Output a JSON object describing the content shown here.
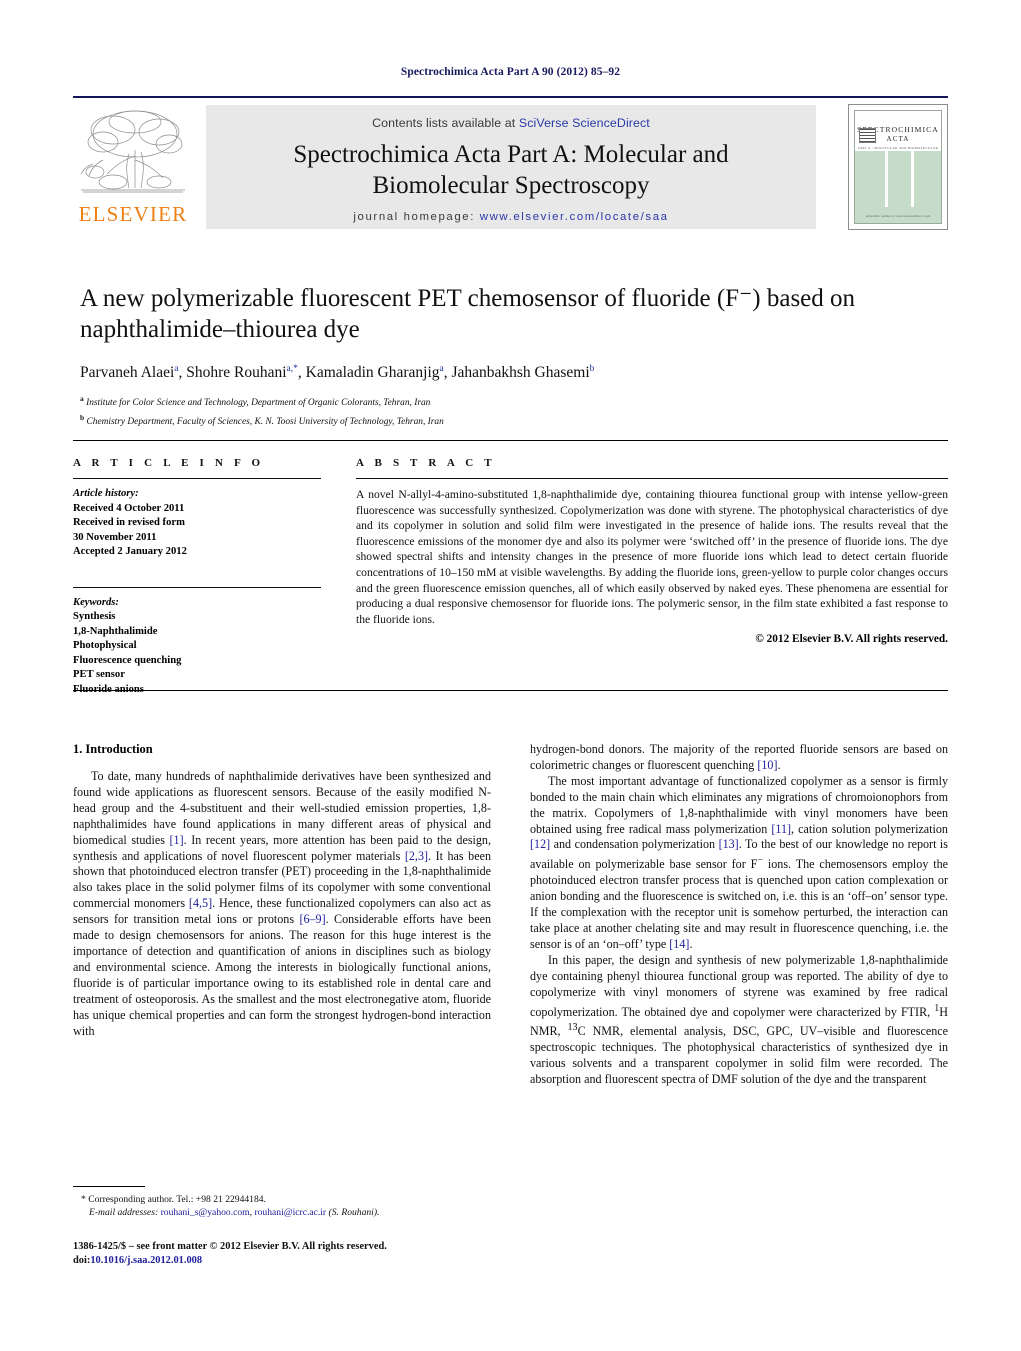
{
  "running_head": "Spectrochimica Acta Part A 90 (2012) 85–92",
  "masthead": {
    "publisher_name": "ELSEVIER",
    "contents_prefix": "Contents lists available at ",
    "contents_link": "SciVerse ScienceDirect",
    "journal_title_line1": "Spectrochimica Acta Part A: Molecular and",
    "journal_title_line2": "Biomolecular Spectroscopy",
    "homepage_label": "journal homepage:",
    "homepage_url": "www.elsevier.com/locate/saa",
    "cover": {
      "title": "SPECTROCHIMICA",
      "subtitle": "ACTA",
      "tagline": "PART A : MOLECULAR AND BIOMOLECULAR SPECTROSCOPY",
      "footer": "Available online at www.sciencedirect.com"
    }
  },
  "article": {
    "title": "A new polymerizable fluorescent PET chemosensor of fluoride (F⁻) based on naphthalimide–thiourea dye",
    "authors_html": "Parvaneh Alaei<sup>a</sup>, Shohre Rouhani<sup>a,*</sup>, Kamaladin Gharanjig<sup>a</sup>, Jahanbakhsh Ghasemi<sup>b</sup>",
    "affiliation_a": "Institute for Color Science and Technology, Department of Organic Colorants, Tehran, Iran",
    "affiliation_b": "Chemistry Department, Faculty of Sciences, K. N. Toosi University of Technology, Tehran, Iran"
  },
  "article_info": {
    "heading": "A R T I C L E    I N F O",
    "history_label": "Article history:",
    "received": "Received 4 October 2011",
    "revised_label": "Received in revised form",
    "revised_date": "30 November 2011",
    "accepted": "Accepted 2 January 2012",
    "keywords_label": "Keywords:",
    "keywords": [
      "Synthesis",
      "1,8-Naphthalimide",
      "Photophysical",
      "Fluorescence quenching",
      "PET sensor",
      "Fluoride anions"
    ]
  },
  "abstract": {
    "heading": "A B S T R A C T",
    "text": "A novel N-allyl-4-amino-substituted 1,8-naphthalimide dye, containing thiourea functional group with intense yellow-green fluorescence was successfully synthesized. Copolymerization was done with styrene. The photophysical characteristics of dye and its copolymer in solution and solid film were investigated in the presence of halide ions. The results reveal that the fluorescence emissions of the monomer dye and also its polymer were ‘switched off’ in the presence of fluoride ions. The dye showed spectral shifts and intensity changes in the presence of more fluoride ions which lead to detect certain fluoride concentrations of 10–150 mM at visible wavelengths. By adding the fluoride ions, green-yellow to purple color changes occurs and the green fluorescence emission quenches, all of which easily observed by naked eyes. These phenomena are essential for producing a dual responsive chemosensor for fluoride ions. The polymeric sensor, in the film state exhibited a fast response to the fluoride ions.",
    "copyright": "© 2012 Elsevier B.V. All rights reserved."
  },
  "body": {
    "section_title": "1.  Introduction",
    "left_para_1_html": "To date, many hundreds of naphthalimide derivatives have been synthesized and found wide applications as fluorescent sensors. Because of the easily modified N-head group and the 4-substituent and their well-studied emission properties, 1,8-naphthalimides have found applications in many different areas of physical and biomedical studies <span class=\"ref\">[1]</span>. In recent years, more attention has been paid to the design, synthesis and applications of novel fluorescent polymer materials <span class=\"ref\">[2,3]</span>. It has been shown that photoinduced electron transfer (PET) proceeding in the 1,8-naphthalimide also takes place in the solid polymer films of its copolymer with some conventional commercial monomers <span class=\"ref\">[4,5]</span>. Hence, these functionalized copolymers can also act as sensors for transition metal ions or protons <span class=\"ref\">[6–9]</span>. Considerable efforts have been made to design chemosensors for anions. The reason for this huge interest is the importance of detection and quantification of anions in disciplines such as biology and environmental science. Among the interests in biologically functional anions, fluoride is of particular importance owing to its established role in dental care and treatment of osteoporosis. As the smallest and the most electronegative atom, fluoride has unique chemical properties and can form the strongest hydrogen-bond interaction with",
    "right_para_1_html": "hydrogen-bond donors. The majority of the reported fluoride sensors are based on colorimetric changes or fluorescent quenching <span class=\"ref\">[10]</span>.",
    "right_para_2_html": "The most important advantage of functionalized copolymer as a sensor is firmly bonded to the main chain which eliminates any migrations of chromoionophors from the matrix. Copolymers of 1,8-naphthalimide with vinyl monomers have been obtained using free radical mass polymerization <span class=\"ref\">[11]</span>, cation solution polymerization <span class=\"ref\">[12]</span> and condensation polymerization <span class=\"ref\">[13]</span>. To the best of our knowledge no report is available on polymerizable base sensor for F<sup>−</sup> ions. The chemosensors employ the photoinduced electron transfer process that is quenched upon cation complexation or anion bonding and the fluorescence is switched on, i.e. this is an ‘off–on’ sensor type. If the complexation with the receptor unit is somehow perturbed, the interaction can take place at another chelating site and may result in fluorescence quenching, i.e. the sensor is of an ‘on–off’ type <span class=\"ref\">[14]</span>.",
    "right_para_3_html": "In this paper, the design and synthesis of new polymerizable 1,8-naphthalimide dye containing phenyl thiourea functional group was reported. The ability of dye to copolymerize with vinyl monomers of styrene was examined by free radical copolymerization. The obtained dye and copolymer were characterized by FTIR, <sup>1</sup>H NMR, <sup>13</sup>C NMR, elemental analysis, DSC, GPC, UV–visible and fluorescence spectroscopic techniques. The photophysical characteristics of synthesized dye in various solvents and a transparent copolymer in solid film were recorded. The absorption and fluorescent spectra of DMF solution of the dye and the transparent"
  },
  "footnotes": {
    "corresponding_html": "* Corresponding author. Tel.: +98 21 22944184.",
    "email_html": "E-mail addresses: <span class=\"mail\">rouhani_s@yahoo.com</span>, <span class=\"mail\">rouhani@icrc.ac.ir</span> (S. Rouhani)."
  },
  "imprint": {
    "line1": "1386-1425/$ – see front matter © 2012 Elsevier B.V. All rights reserved.",
    "doi_prefix": "doi:",
    "doi_value": "10.1016/j.saa.2012.01.008"
  },
  "colors": {
    "link_blue": "#20209c",
    "elsevier_orange": "#ec8013",
    "rule_navy": "#14145a",
    "banner_gray": "#e8e8e8",
    "cover_green": "#c6dcc8"
  }
}
